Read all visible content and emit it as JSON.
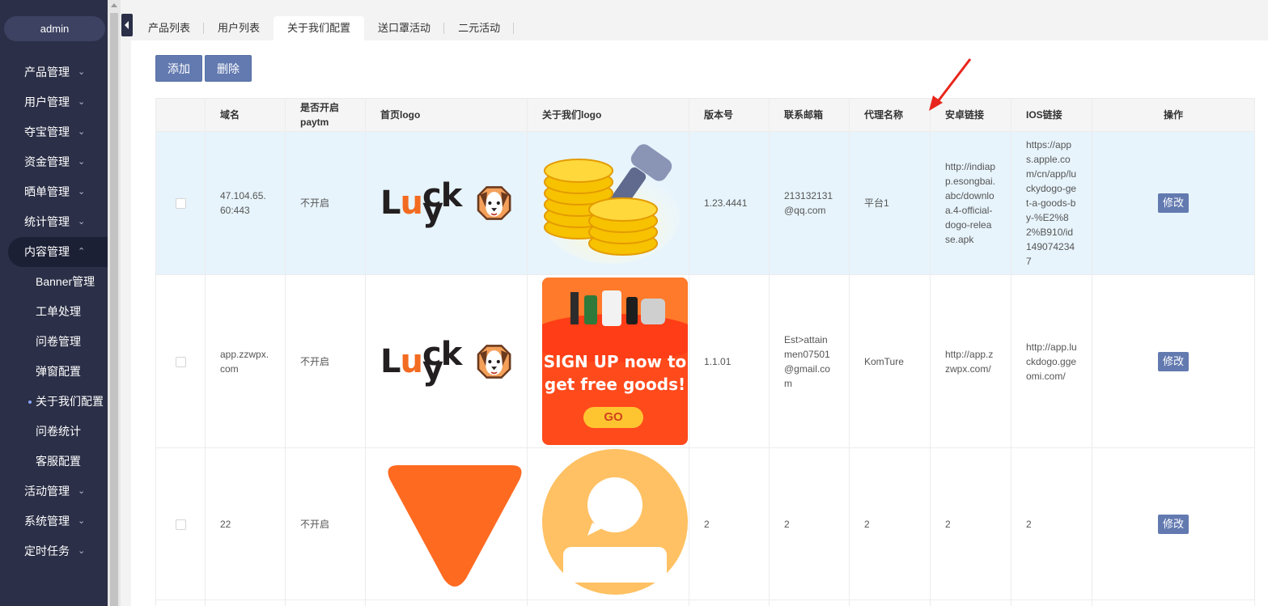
{
  "user": {
    "name": "admin"
  },
  "sidebar": {
    "items": [
      {
        "label": "产品管理"
      },
      {
        "label": "用户管理"
      },
      {
        "label": "夺宝管理"
      },
      {
        "label": "资金管理"
      },
      {
        "label": "晒单管理"
      },
      {
        "label": "统计管理"
      },
      {
        "label": "内容管理"
      },
      {
        "label": "活动管理"
      },
      {
        "label": "系统管理"
      },
      {
        "label": "定时任务"
      }
    ],
    "content_sub": [
      {
        "label": "Banner管理"
      },
      {
        "label": "工单处理"
      },
      {
        "label": "问卷管理"
      },
      {
        "label": "弹窗配置"
      },
      {
        "label": "关于我们配置"
      },
      {
        "label": "问卷统计"
      },
      {
        "label": "客服配置"
      }
    ]
  },
  "tabs": [
    {
      "label": "产品列表"
    },
    {
      "label": "用户列表"
    },
    {
      "label": "关于我们配置"
    },
    {
      "label": "送口罩活动"
    },
    {
      "label": "二元活动"
    }
  ],
  "toolbar": {
    "add_label": "添加",
    "delete_label": "删除"
  },
  "table": {
    "headers": {
      "domain": "域名",
      "paytm_line1": "是否开启",
      "paytm_line2": "paytm",
      "home_logo": "首页logo",
      "about_logo": "关于我们logo",
      "version": "版本号",
      "email": "联系邮箱",
      "agent": "代理名称",
      "android": "安卓链接",
      "ios": "IOS链接",
      "action": "操作"
    },
    "rows": [
      {
        "domain": "47.104.65.60:443",
        "paytm": "不开启",
        "version": "1.23.4441",
        "email": "213132131@qq.com",
        "agent": "平台1",
        "android": "http://indiapp.esongbai.abc/downloa.4-official-dogo-release.apk",
        "ios": "https://apps.apple.com/cn/app/luckydogo-get-a-goods-by-%E2%82%B910/id1490742347",
        "action": "修改"
      },
      {
        "domain": "app.zzwpx.com",
        "paytm": "不开启",
        "version": "1.1.01",
        "email": "Est>attainmen07501@gmail.com",
        "agent": "KomTure",
        "android": "http://app.zzwpx.com/",
        "ios": "http://app.luckdogo.ggeomi.com/",
        "action": "修改"
      },
      {
        "domain": "22",
        "paytm": "不开启",
        "version": "2",
        "email": "2",
        "agent": "2",
        "android": "2",
        "ios": "2",
        "action": "修改"
      }
    ]
  },
  "logos": {
    "lucky_text_1": "L",
    "lucky_text_2": "u",
    "lucky_text_3": "cky",
    "promo_line1": "SIGN UP now to",
    "promo_line2": "get free goods!",
    "promo_button": "GO"
  },
  "colors": {
    "sidebar_bg": "#2b2f47",
    "primary_button": "#637ab0",
    "row_highlight": "#e7f4fc",
    "annotation_arrow": "#e8251c"
  }
}
